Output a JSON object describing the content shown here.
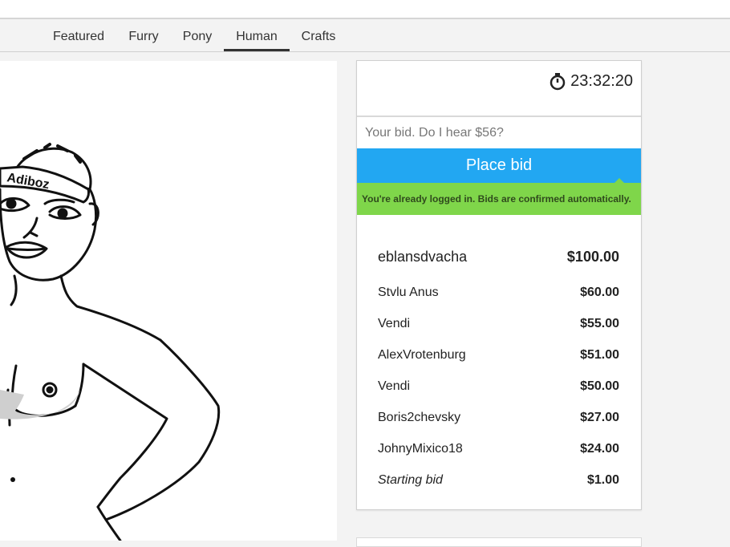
{
  "tabs": [
    {
      "label": "Featured",
      "active": false
    },
    {
      "label": "Furry",
      "active": false
    },
    {
      "label": "Pony",
      "active": false
    },
    {
      "label": "Human",
      "active": true
    },
    {
      "label": "Crafts",
      "active": false
    }
  ],
  "artwork": {
    "cap_text": "Adiboz"
  },
  "auction": {
    "timer": "23:32:20",
    "timer_icon": "stopwatch-icon",
    "bid_placeholder": "Your bid. Do I hear $56?",
    "place_bid_label": "Place bid",
    "notice": "You're already logged in. Bids are confirmed automatically."
  },
  "bids": [
    {
      "name": "eblansdvacha",
      "amount": "$100.00"
    },
    {
      "name": "Stvlu Anus",
      "amount": "$60.00"
    },
    {
      "name": "Vendi",
      "amount": "$55.00"
    },
    {
      "name": "AlexVrotenburg",
      "amount": "$51.00"
    },
    {
      "name": "Vendi",
      "amount": "$50.00"
    },
    {
      "name": "Boris2chevsky",
      "amount": "$27.00"
    },
    {
      "name": "JohnyMixico18",
      "amount": "$24.00"
    },
    {
      "name": "Starting bid",
      "amount": "$1.00"
    }
  ],
  "colors": {
    "accent": "#22a7f2",
    "success": "#7fd64a",
    "tab_active": "#333333"
  }
}
